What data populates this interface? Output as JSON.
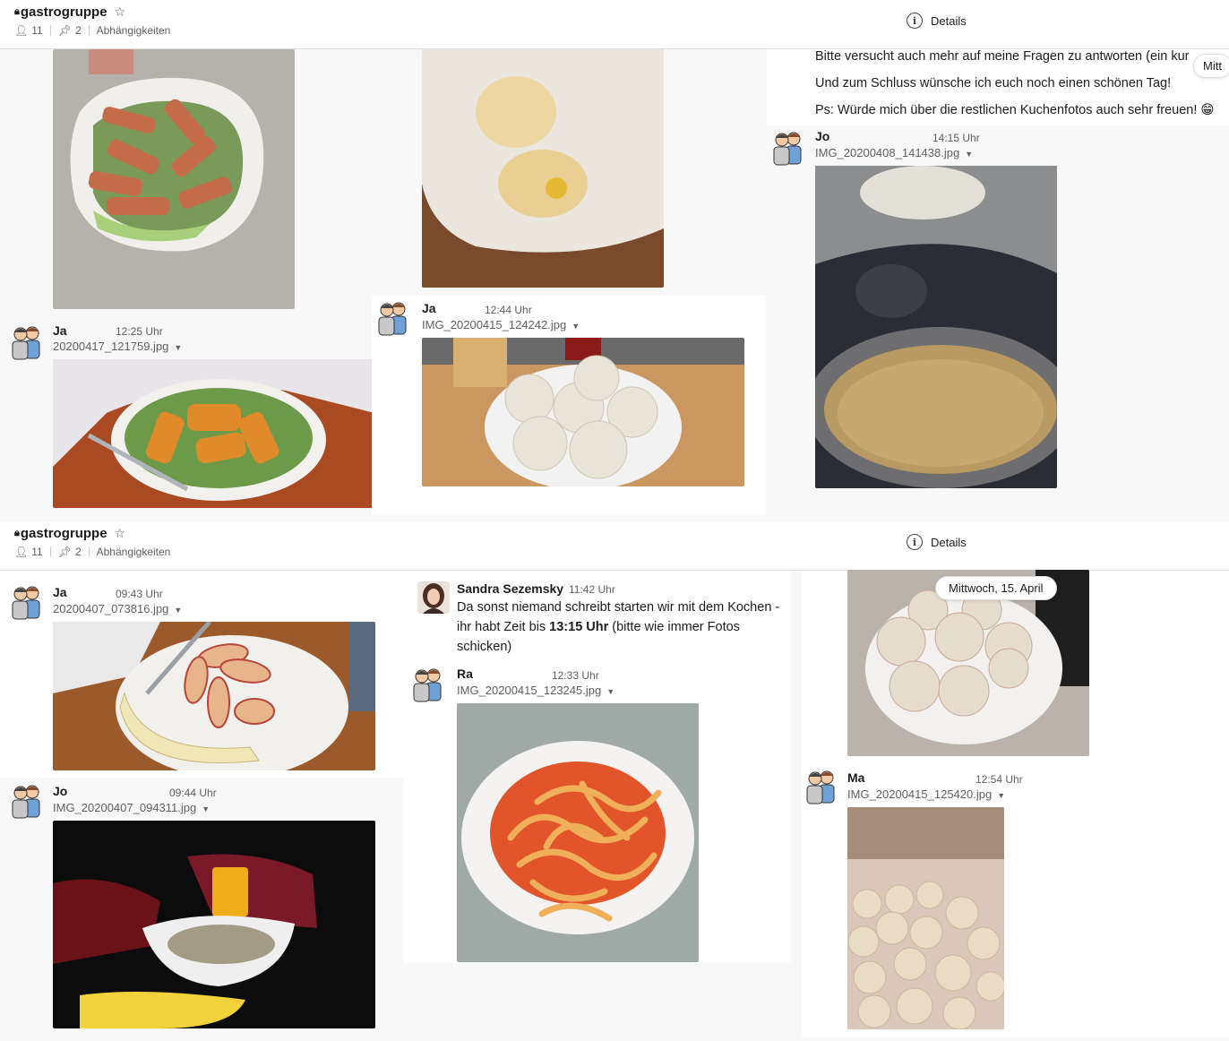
{
  "screens": [
    {
      "channel": {
        "name": "gastrogruppe",
        "members": "11",
        "pinned": "2",
        "bookmarks_label": "Abhängigkeiten",
        "details_label": "Details"
      }
    },
    {
      "channel": {
        "name": "gastrogruppe",
        "members": "11",
        "pinned": "2",
        "bookmarks_label": "Abhängigkeiten",
        "details_label": "Details"
      }
    }
  ],
  "top": {
    "col1": {
      "author": "Ja",
      "time": "12:25 Uhr",
      "file": "20200417_121759.jpg"
    },
    "col2": {
      "author": "Ja",
      "time": "12:44 Uhr",
      "file": "IMG_20200415_124242.jpg"
    },
    "col3": {
      "lines": [
        "Bitte versucht auch mehr auf meine Fragen zu antworten (ein kur",
        "Und zum Schluss wünsche ich euch noch einen schönen Tag!",
        "Ps: Würde mich über die restlichen Kuchenfotos auch sehr freuen! 😁"
      ],
      "date_pill": "Mitt",
      "author": "Jo",
      "time": "14:15 Uhr",
      "file": "IMG_20200408_141438.jpg"
    }
  },
  "bottom": {
    "col1": [
      {
        "author": "Ja",
        "time": "09:43 Uhr",
        "file": "20200407_073816.jpg"
      },
      {
        "author": "Jo",
        "time": "09:44 Uhr",
        "file": "IMG_20200407_094311.jpg"
      }
    ],
    "col2": {
      "sandra": {
        "author": "Sandra Sezemsky",
        "time": "11:42 Uhr",
        "text_before": "Da sonst niemand schreibt starten wir mit dem Kochen - ihr habt Zeit  bis ",
        "text_bold": "13:15 Uhr",
        "text_after": " (bitte wie immer Fotos schicken)"
      },
      "second": {
        "author": "Ra",
        "time": "12:33 Uhr",
        "file": "IMG_20200415_123245.jpg"
      }
    },
    "col3": {
      "date_pill": "Mittwoch, 15. April",
      "author": "Ma",
      "time": "12:54 Uhr",
      "file": "IMG_20200415_125420.jpg"
    }
  },
  "colors": {
    "brand_text": "#1d1c1d",
    "meta_text": "#616061",
    "divider": "#dddddd"
  }
}
